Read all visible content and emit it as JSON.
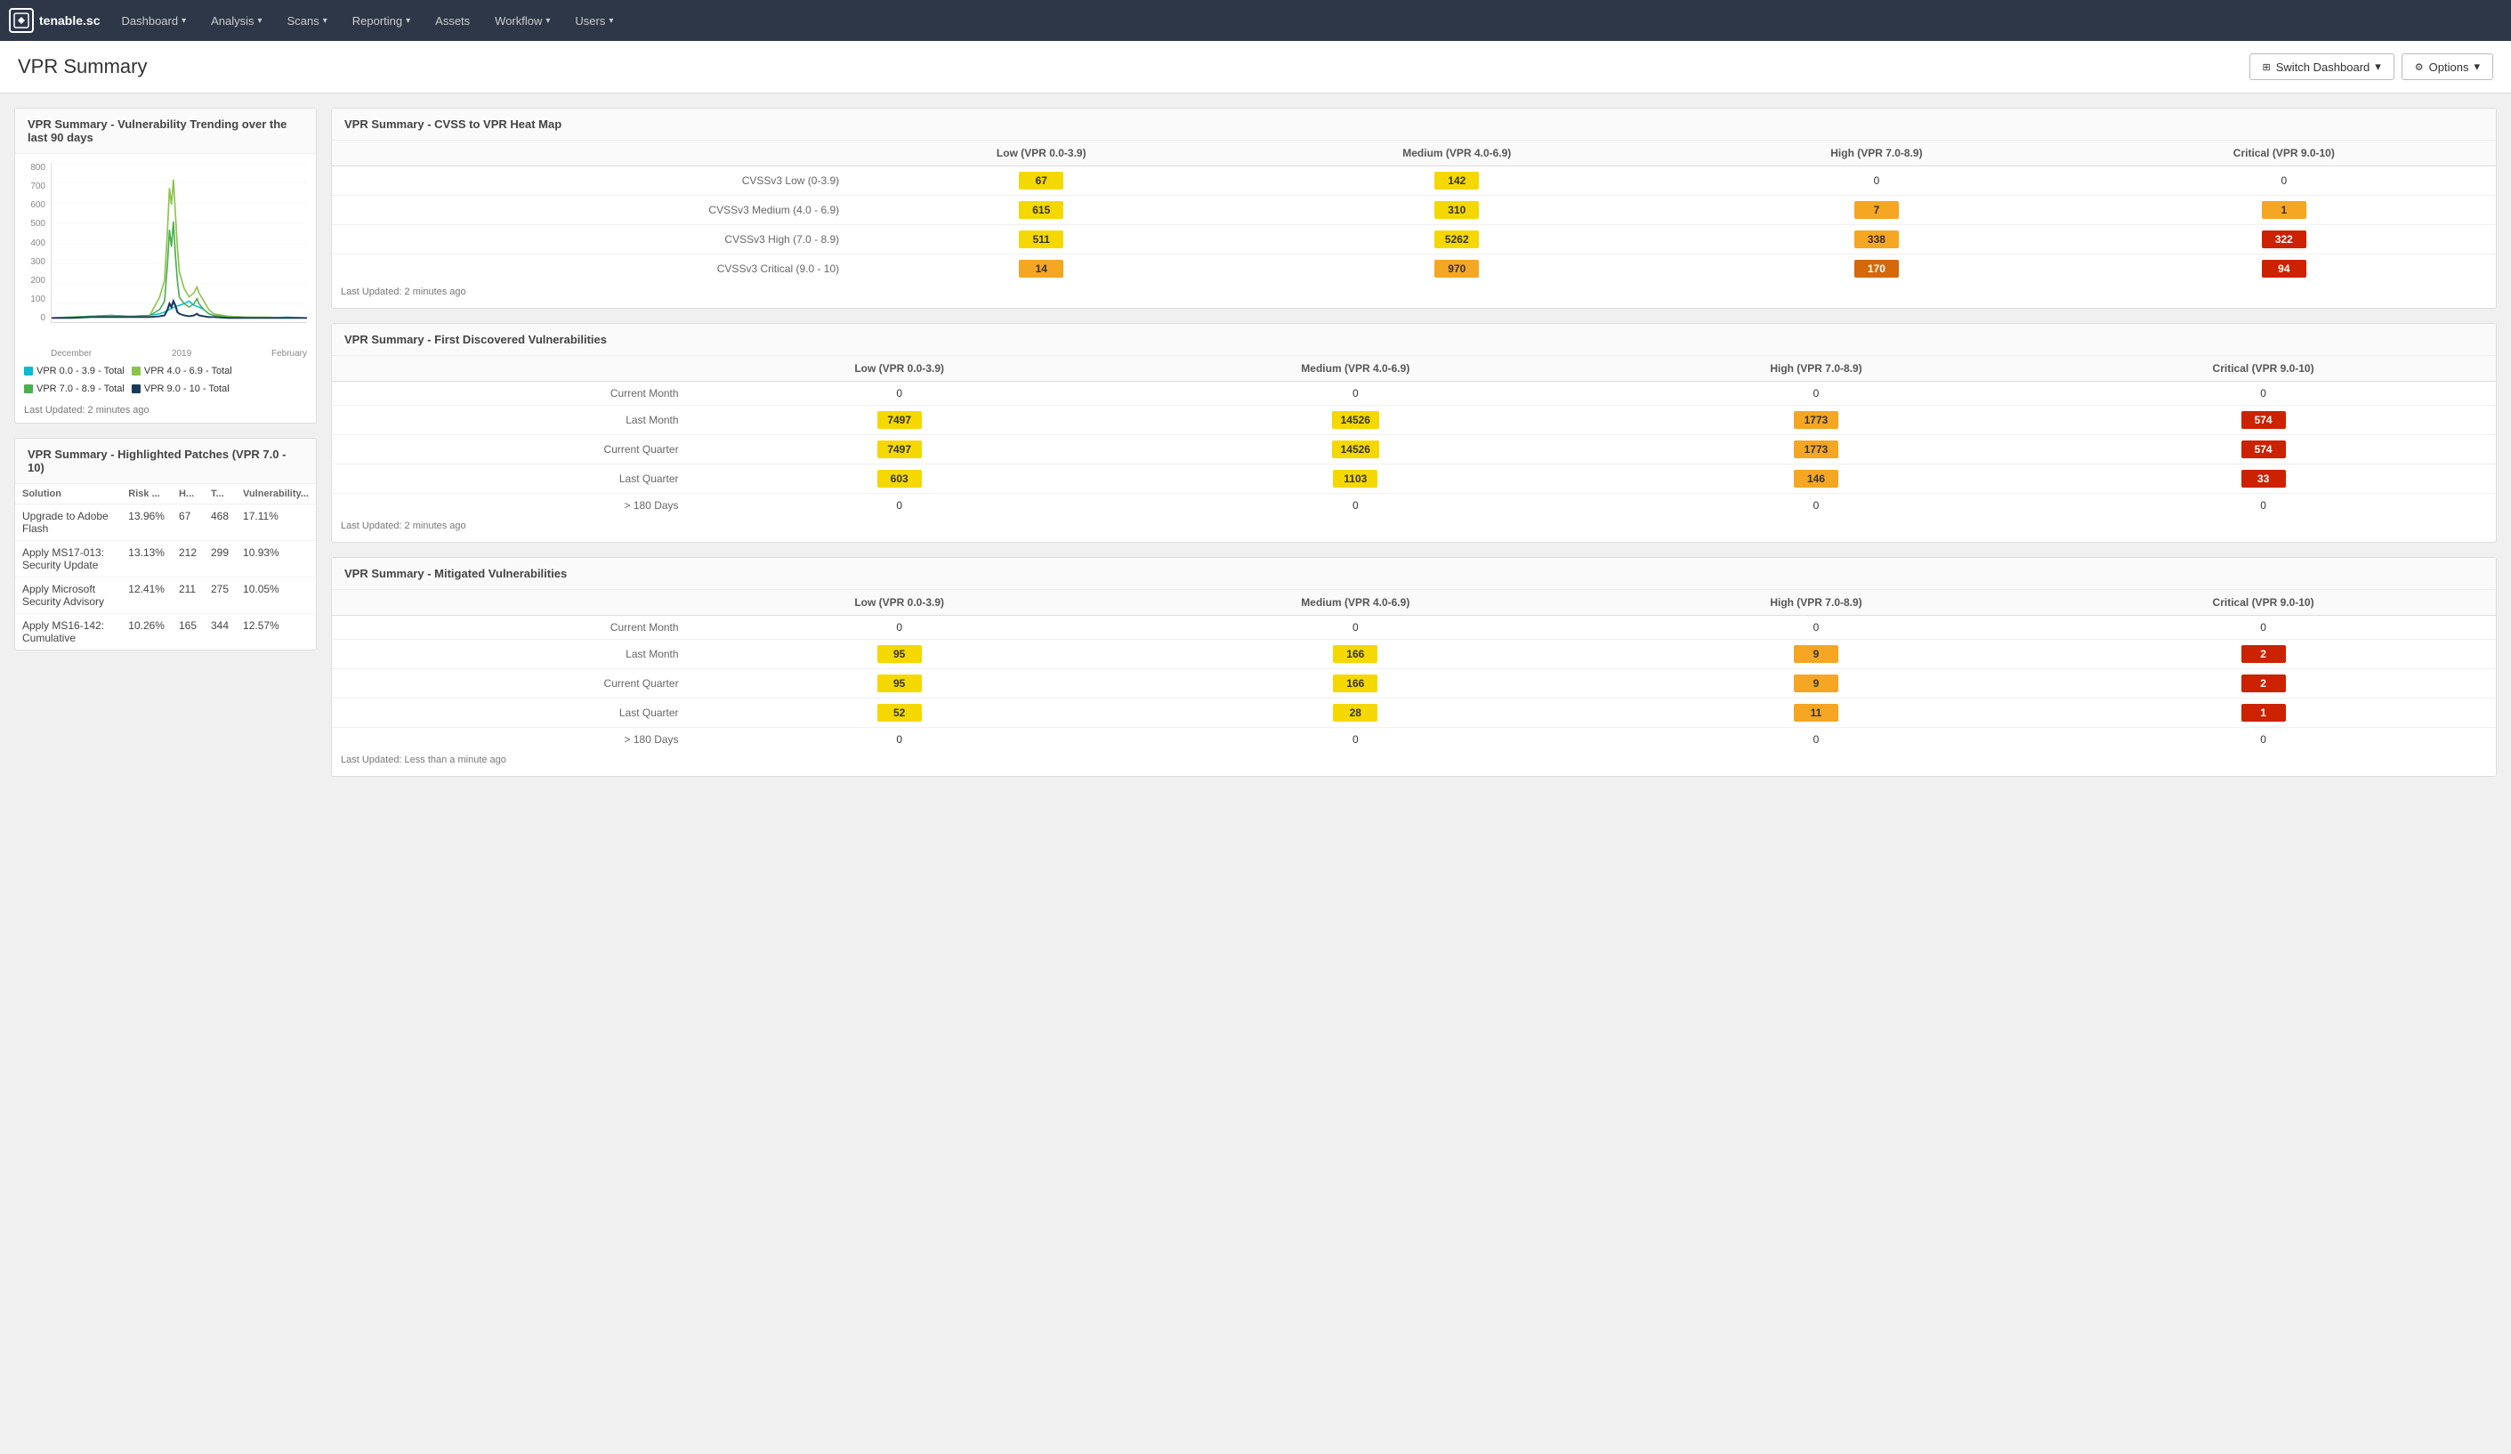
{
  "brand": {
    "name": "tenable.sc"
  },
  "nav": {
    "items": [
      {
        "label": "Dashboard",
        "caret": true
      },
      {
        "label": "Analysis",
        "caret": true
      },
      {
        "label": "Scans",
        "caret": true
      },
      {
        "label": "Reporting",
        "caret": true
      },
      {
        "label": "Assets",
        "caret": false
      },
      {
        "label": "Workflow",
        "caret": true
      },
      {
        "label": "Users",
        "caret": true
      }
    ]
  },
  "header": {
    "title": "VPR Summary",
    "switch_dashboard": "Switch Dashboard",
    "options": "Options"
  },
  "trending_card": {
    "title": "VPR Summary - Vulnerability Trending over the last 90 days",
    "y_labels": [
      "800",
      "700",
      "600",
      "500",
      "400",
      "300",
      "200",
      "100",
      "0"
    ],
    "x_labels": [
      "December",
      "2019",
      "February"
    ],
    "legend": [
      {
        "label": "VPR 0.0 - 3.9 - Total",
        "color": "#00bcd4"
      },
      {
        "label": "VPR 4.0 - 6.9 - Total",
        "color": "#8bc34a"
      },
      {
        "label": "VPR 7.0 - 8.9 - Total",
        "color": "#4caf50"
      },
      {
        "label": "VPR 9.0 - 10 - Total",
        "color": "#1a3a5c"
      }
    ],
    "last_updated": "Last Updated: 2 minutes ago"
  },
  "patches_card": {
    "title": "VPR Summary - Highlighted Patches (VPR 7.0 - 10)",
    "columns": [
      "Solution",
      "Risk ...",
      "H...",
      "T...",
      "Vulnerability..."
    ],
    "rows": [
      {
        "solution": "Upgrade to Adobe Flash",
        "risk": "13.96%",
        "h": "67",
        "t": "468",
        "vuln": "17.11%"
      },
      {
        "solution": "Apply MS17-013: Security Update",
        "risk": "13.13%",
        "h": "212",
        "t": "299",
        "vuln": "10.93%"
      },
      {
        "solution": "Apply Microsoft Security Advisory",
        "risk": "12.41%",
        "h": "211",
        "t": "275",
        "vuln": "10.05%"
      },
      {
        "solution": "Apply MS16-142: Cumulative",
        "risk": "10.26%",
        "h": "165",
        "t": "344",
        "vuln": "12.57%"
      }
    ]
  },
  "heatmap_card": {
    "title": "VPR Summary - CVSS to VPR Heat Map",
    "col_headers": [
      "",
      "Low (VPR 0.0-3.9)",
      "Medium (VPR 4.0-6.9)",
      "High (VPR 7.0-8.9)",
      "Critical (VPR 9.0-10)"
    ],
    "rows": [
      {
        "label": "CVSSv3 Low (0-3.9)",
        "cells": [
          {
            "value": "67",
            "bg": "bg-yellow"
          },
          {
            "value": "142",
            "bg": "bg-yellow"
          },
          {
            "value": "0",
            "bg": ""
          },
          {
            "value": "0",
            "bg": ""
          }
        ]
      },
      {
        "label": "CVSSv3 Medium (4.0 - 6.9)",
        "cells": [
          {
            "value": "615",
            "bg": "bg-yellow"
          },
          {
            "value": "310",
            "bg": "bg-yellow"
          },
          {
            "value": "7",
            "bg": "bg-orange-light"
          },
          {
            "value": "1",
            "bg": "bg-orange-light"
          }
        ]
      },
      {
        "label": "CVSSv3 High (7.0 - 8.9)",
        "cells": [
          {
            "value": "511",
            "bg": "bg-yellow"
          },
          {
            "value": "5262",
            "bg": "bg-yellow"
          },
          {
            "value": "338",
            "bg": "bg-orange-light"
          },
          {
            "value": "322",
            "bg": "bg-red"
          }
        ]
      },
      {
        "label": "CVSSv3 Critical (9.0 - 10)",
        "cells": [
          {
            "value": "14",
            "bg": "bg-orange-light"
          },
          {
            "value": "970",
            "bg": "bg-orange-light"
          },
          {
            "value": "170",
            "bg": "bg-orange-dark"
          },
          {
            "value": "94",
            "bg": "bg-red"
          }
        ]
      }
    ],
    "last_updated": "Last Updated: 2 minutes ago"
  },
  "first_discovered_card": {
    "title": "VPR Summary - First Discovered Vulnerabilities",
    "col_headers": [
      "",
      "Low (VPR 0.0-3.9)",
      "Medium (VPR 4.0-6.9)",
      "High (VPR 7.0-8.9)",
      "Critical (VPR 9.0-10)"
    ],
    "rows": [
      {
        "label": "Current Month",
        "cells": [
          {
            "value": "0",
            "bg": ""
          },
          {
            "value": "0",
            "bg": ""
          },
          {
            "value": "0",
            "bg": ""
          },
          {
            "value": "0",
            "bg": ""
          }
        ]
      },
      {
        "label": "Last Month",
        "cells": [
          {
            "value": "7497",
            "bg": "bg-yellow"
          },
          {
            "value": "14526",
            "bg": "bg-yellow"
          },
          {
            "value": "1773",
            "bg": "bg-orange-light"
          },
          {
            "value": "574",
            "bg": "bg-red"
          }
        ]
      },
      {
        "label": "Current Quarter",
        "cells": [
          {
            "value": "7497",
            "bg": "bg-yellow"
          },
          {
            "value": "14526",
            "bg": "bg-yellow"
          },
          {
            "value": "1773",
            "bg": "bg-orange-light"
          },
          {
            "value": "574",
            "bg": "bg-red"
          }
        ]
      },
      {
        "label": "Last Quarter",
        "cells": [
          {
            "value": "603",
            "bg": "bg-yellow"
          },
          {
            "value": "1103",
            "bg": "bg-yellow"
          },
          {
            "value": "146",
            "bg": "bg-orange-light"
          },
          {
            "value": "33",
            "bg": "bg-red"
          }
        ]
      },
      {
        "label": "> 180 Days",
        "cells": [
          {
            "value": "0",
            "bg": ""
          },
          {
            "value": "0",
            "bg": ""
          },
          {
            "value": "0",
            "bg": ""
          },
          {
            "value": "0",
            "bg": ""
          }
        ]
      }
    ],
    "last_updated": "Last Updated: 2 minutes ago"
  },
  "mitigated_card": {
    "title": "VPR Summary - Mitigated Vulnerabilities",
    "col_headers": [
      "",
      "Low (VPR 0.0-3.9)",
      "Medium (VPR 4.0-6.9)",
      "High (VPR 7.0-8.9)",
      "Critical (VPR 9.0-10)"
    ],
    "rows": [
      {
        "label": "Current Month",
        "cells": [
          {
            "value": "0",
            "bg": ""
          },
          {
            "value": "0",
            "bg": ""
          },
          {
            "value": "0",
            "bg": ""
          },
          {
            "value": "0",
            "bg": ""
          }
        ]
      },
      {
        "label": "Last Month",
        "cells": [
          {
            "value": "95",
            "bg": "bg-yellow"
          },
          {
            "value": "166",
            "bg": "bg-yellow"
          },
          {
            "value": "9",
            "bg": "bg-orange-light"
          },
          {
            "value": "2",
            "bg": "bg-red"
          }
        ]
      },
      {
        "label": "Current Quarter",
        "cells": [
          {
            "value": "95",
            "bg": "bg-yellow"
          },
          {
            "value": "166",
            "bg": "bg-yellow"
          },
          {
            "value": "9",
            "bg": "bg-orange-light"
          },
          {
            "value": "2",
            "bg": "bg-red"
          }
        ]
      },
      {
        "label": "Last Quarter",
        "cells": [
          {
            "value": "52",
            "bg": "bg-yellow"
          },
          {
            "value": "28",
            "bg": "bg-yellow"
          },
          {
            "value": "11",
            "bg": "bg-orange-light"
          },
          {
            "value": "1",
            "bg": "bg-red"
          }
        ]
      },
      {
        "label": "> 180 Days",
        "cells": [
          {
            "value": "0",
            "bg": ""
          },
          {
            "value": "0",
            "bg": ""
          },
          {
            "value": "0",
            "bg": ""
          },
          {
            "value": "0",
            "bg": ""
          }
        ]
      }
    ],
    "last_updated": "Last Updated: Less than a minute ago"
  }
}
